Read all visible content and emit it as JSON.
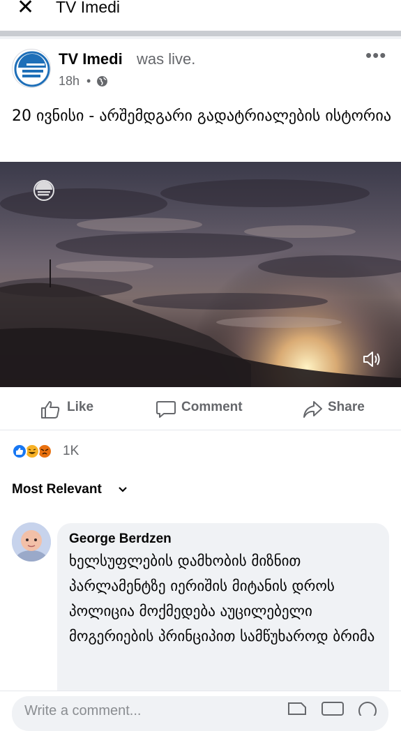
{
  "header": {
    "title": "TV Imedi"
  },
  "post": {
    "page_name": "TV Imedi",
    "status": "was live.",
    "time": "18h",
    "caption": "20 ივნისი - არშემდგარი გადატრიალების ისტორია"
  },
  "actions": {
    "like": "Like",
    "comment": "Comment",
    "share": "Share"
  },
  "reactions": {
    "count": "1K"
  },
  "comments": {
    "sort_label": "Most Relevant",
    "items": [
      {
        "author": "George Berdzen",
        "text": "ხელსუფლების დამხობის მიზნით პარლამენტზე იერიშის მიტანის დროს პოლიცია მოქმედება აუცილებელი მოგერიების პრინციპით სამწუხაროდ ბრიმა"
      }
    ]
  },
  "composer": {
    "placeholder": "Write a comment..."
  },
  "colors": {
    "like_blue": "#1877f2",
    "haha_yellow": "#f7b125",
    "angry_orange": "#e9710f",
    "text_gray": "#65676b"
  }
}
